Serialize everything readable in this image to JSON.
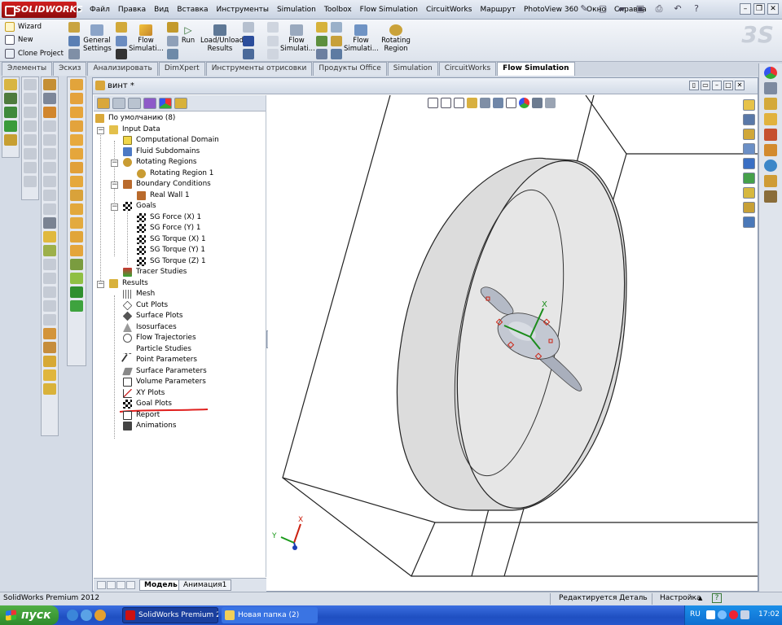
{
  "app": {
    "logo_text": "SOLIDWORKS",
    "menu": [
      "Файл",
      "Правка",
      "Вид",
      "Вставка",
      "Инструменты",
      "Simulation",
      "Toolbox",
      "Flow Simulation",
      "CircuitWorks",
      "Маршрут",
      "PhotoView 360",
      "Окно",
      "Справка"
    ]
  },
  "command_manager": {
    "side_items": [
      "Wizard",
      "New",
      "Clone Project"
    ],
    "buttons": {
      "general_settings": "General Settings",
      "flow_sim_1": "Flow Simulati...",
      "run": "Run",
      "load_unload": "Load/Unload Results",
      "flow_2": "Flow Simulati...",
      "flow_3": "Flow Simulati...",
      "rotating_region": "Rotating Region"
    },
    "tabs": [
      {
        "label": "Элементы",
        "active": false
      },
      {
        "label": "Эскиз",
        "active": false
      },
      {
        "label": "Анализировать",
        "active": false
      },
      {
        "label": "DimXpert",
        "active": false
      },
      {
        "label": "Инструменты отрисовки",
        "active": false
      },
      {
        "label": "Продукты Office",
        "active": false
      },
      {
        "label": "Simulation",
        "active": false
      },
      {
        "label": "CircuitWorks",
        "active": false
      },
      {
        "label": "Flow Simulation",
        "active": true
      }
    ]
  },
  "document": {
    "title": "винт *"
  },
  "tree": {
    "root": "По умолчанию (8)",
    "input_data": "Input Data",
    "computational_domain": "Computational Domain",
    "fluid_subdomains": "Fluid Subdomains",
    "rotating_regions": "Rotating Regions",
    "rotating_region_1": "Rotating Region 1",
    "boundary_conditions": "Boundary Conditions",
    "real_wall_1": "Real Wall 1",
    "goals": "Goals",
    "goal_items": [
      "SG Force (X) 1",
      "SG Force (Y) 1",
      "SG Torque (X) 1",
      "SG Torque (Y) 1",
      "SG Torque (Z) 1"
    ],
    "tracer_studies": "Tracer Studies",
    "results": "Results",
    "result_items": [
      "Mesh",
      "Cut Plots",
      "Surface Plots",
      "Isosurfaces",
      "Flow Trajectories",
      "Particle Studies",
      "Point Parameters",
      "Surface Parameters",
      "Volume Parameters",
      "XY Plots",
      "Goal Plots",
      "Report",
      "Animations"
    ]
  },
  "bottom_tabs": [
    "Модель",
    "Анимация1"
  ],
  "triad": {
    "x": "X",
    "y": "Y"
  },
  "model_triad": {
    "x": "X"
  },
  "status_bar": {
    "product": "SolidWorks Premium 2012",
    "state": "Редактируется Деталь",
    "settings": "Настройка",
    "settings_arrow": "▲",
    "help": "?"
  },
  "taskbar": {
    "start": "пуск",
    "tasks": [
      "SolidWorks Premium 2...",
      "Новая папка (2)"
    ],
    "lang": "RU",
    "time": "17:02"
  },
  "colors": {
    "accent_red": "#cc1111",
    "taskbar_blue": "#245edb",
    "start_green": "#3c9a36",
    "annotation_underline": "#e0201e"
  },
  "icons": {
    "logo": "solidworks-logo-icon",
    "start": "windows-flag-icon"
  }
}
